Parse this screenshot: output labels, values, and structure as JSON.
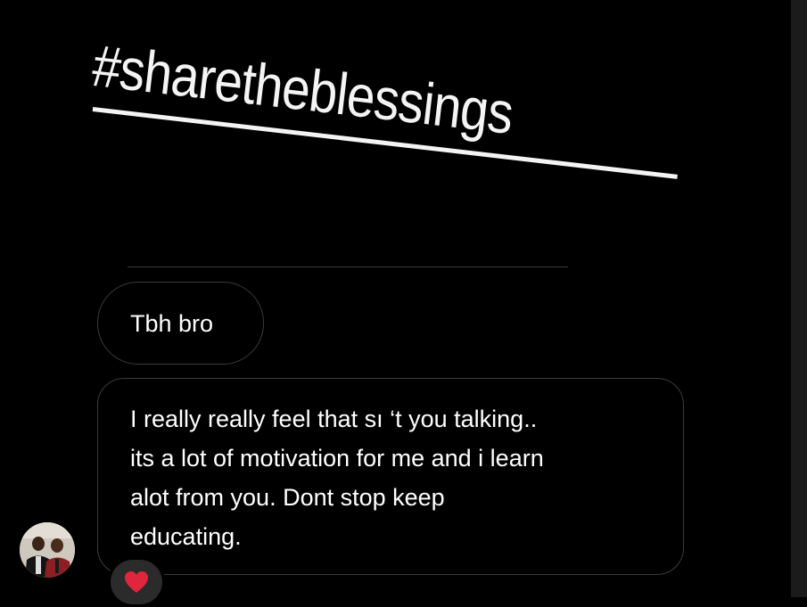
{
  "story": {
    "hashtag": "#sharetheblessings"
  },
  "messages": [
    {
      "lines": [
        "Tbh bro"
      ]
    },
    {
      "lines": [
        "I really really feel that sı ‘t you talking..",
        "its a lot of motivation for me and i learn",
        "alot from you. Dont stop keep",
        "educating."
      ]
    }
  ],
  "reaction": {
    "icon": "heart-icon",
    "color": "#e0263c"
  },
  "colors": {
    "background": "#000000",
    "bubble_border": "#3b3b3b",
    "text": "#ffffff"
  }
}
